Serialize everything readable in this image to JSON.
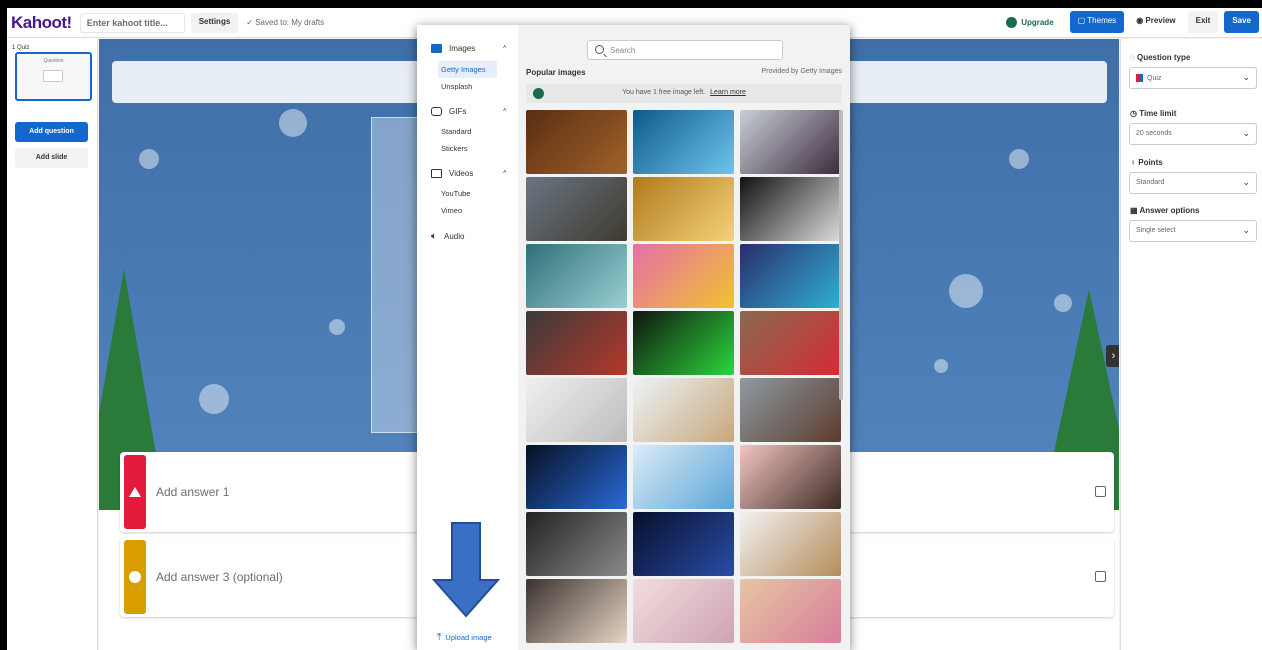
{
  "topbar": {
    "logo": "Kahoot!",
    "title_placeholder": "Enter kahoot title...",
    "settings": "Settings",
    "saved": "✓  Saved to: My drafts",
    "upgrade": "Upgrade",
    "themes": "Themes",
    "preview": "Preview",
    "exit": "Exit",
    "save": "Save"
  },
  "leftbar": {
    "slide_label": "1 Quiz",
    "slide_thumb_label": "Question",
    "add_question": "Add question",
    "add_slide": "Add slide"
  },
  "canvas": {
    "answers": [
      {
        "text": "Add answer 1",
        "color": "#e21b3c",
        "shape": "triangle"
      },
      {
        "text": "Add answer 3 (optional)",
        "color": "#d89e00",
        "shape": "circle"
      }
    ],
    "next_arrow": "›"
  },
  "rightbar": {
    "question_type_label": "Question type",
    "question_type_value": "Quiz",
    "time_limit_label": "Time limit",
    "time_limit_value": "20 seconds",
    "points_label": "Points",
    "points_value": "Standard",
    "answer_options_label": "Answer options",
    "answer_options_value": "Single select"
  },
  "modal": {
    "categories": [
      {
        "label": "Images",
        "icon": "image-icon",
        "subs": [
          "Getty Images",
          "Unsplash"
        ]
      },
      {
        "label": "GIFs",
        "icon": "gif-icon",
        "subs": [
          "Standard",
          "Stickers"
        ]
      },
      {
        "label": "Videos",
        "icon": "video-icon",
        "subs": [
          "YouTube",
          "Vimeo"
        ]
      },
      {
        "label": "Audio",
        "icon": "audio-icon",
        "subs": []
      }
    ],
    "search_placeholder": "Search",
    "popular": "Popular images",
    "provided": "Provided by Getty Images",
    "free_text": "You have 1 free image left.",
    "learn_more": "Learn more",
    "upload": "Upload image",
    "thumbnails": [
      {
        "name": "coffee-beans",
        "c1": "#5a2e12",
        "c2": "#a0622a"
      },
      {
        "name": "spotlight-blue",
        "c1": "#0e5a8a",
        "c2": "#6ec4ef"
      },
      {
        "name": "boy-laptop",
        "c1": "#c9cfd6",
        "c2": "#3b2a3d"
      },
      {
        "name": "wind-turbine",
        "c1": "#6b7584",
        "c2": "#3e3a2e"
      },
      {
        "name": "stage-lights",
        "c1": "#b07a1e",
        "c2": "#f4d27a"
      },
      {
        "name": "light-beams",
        "c1": "#111111",
        "c2": "#dddddd"
      },
      {
        "name": "hand-chart",
        "c1": "#2f6f79",
        "c2": "#9ad0d3"
      },
      {
        "name": "pop-art-faces",
        "c1": "#e56fa7",
        "c2": "#f2c230"
      },
      {
        "name": "gamer",
        "c1": "#2a2d6b",
        "c2": "#2eb1d6"
      },
      {
        "name": "red-blocks",
        "c1": "#3a3a3a",
        "c2": "#b5382a"
      },
      {
        "name": "green-screen",
        "c1": "#101510",
        "c2": "#2bd63c"
      },
      {
        "name": "kids-couch",
        "c1": "#8a6a4e",
        "c2": "#d52b35"
      },
      {
        "name": "dots-circle",
        "c1": "#f0f0f0",
        "c2": "#bcbcbc"
      },
      {
        "name": "girl-science",
        "c1": "#eef3f6",
        "c2": "#c7a77c"
      },
      {
        "name": "woman-cheering",
        "c1": "#8e9aa3",
        "c2": "#5c3b2c"
      },
      {
        "name": "xray-body",
        "c1": "#051024",
        "c2": "#2a6ad6"
      },
      {
        "name": "brain-xray",
        "c1": "#dcecf7",
        "c2": "#5aa5d6"
      },
      {
        "name": "cartoon-people",
        "c1": "#f3c6c2",
        "c2": "#3e2a24"
      },
      {
        "name": "football-player",
        "c1": "#222222",
        "c2": "#8a8a8a"
      },
      {
        "name": "heartbeat",
        "c1": "#06102b",
        "c2": "#2a4ca8"
      },
      {
        "name": "sparkle-ball",
        "c1": "#f2f2f2",
        "c2": "#b58c5a"
      },
      {
        "name": "carousel",
        "c1": "#3a3230",
        "c2": "#e6d6c4"
      },
      {
        "name": "pink-scene",
        "c1": "#f1dde0",
        "c2": "#cfa3b0"
      },
      {
        "name": "woman-hat",
        "c1": "#e7c5a2",
        "c2": "#d77f9c"
      }
    ]
  }
}
